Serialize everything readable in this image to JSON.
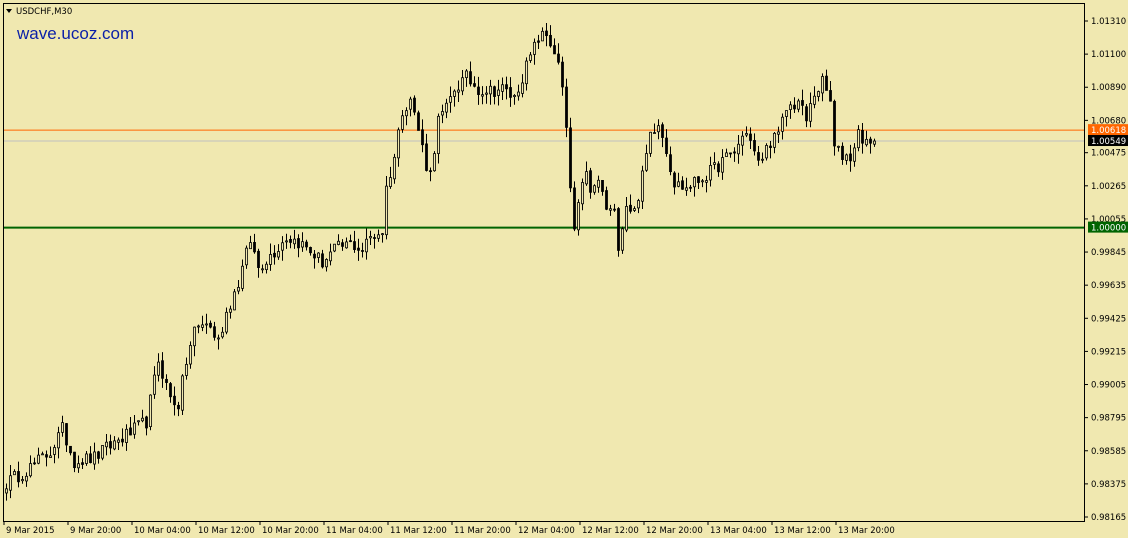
{
  "header": {
    "symbol_label": "USDCHF,M30",
    "watermark": "wave.ucoz.com"
  },
  "colors": {
    "background": "#f0e8b0",
    "candle_up_body": "#f0e8b0",
    "candle_down_body": "#000000",
    "wick": "#000000",
    "orange_line": "#ff6600",
    "green_line": "#006400",
    "bid_line": "#c0c0c0",
    "watermark": "#0a1fa8"
  },
  "chart_data": {
    "type": "candlestick",
    "symbol": "USDCHF",
    "timeframe": "M30",
    "ylim": [
      0.98165,
      1.0131
    ],
    "price_ticks": [
      "1.01310",
      "1.01100",
      "1.00890",
      "1.00680",
      "1.00475",
      "1.00265",
      "1.00055",
      "0.99845",
      "0.99635",
      "0.99425",
      "0.99215",
      "0.99005",
      "0.98795",
      "0.98585",
      "0.98375",
      "0.98165"
    ],
    "time_labels": [
      "9 Mar 2015",
      "9 Mar 20:00",
      "10 Mar 04:00",
      "10 Mar 12:00",
      "10 Mar 20:00",
      "11 Mar 04:00",
      "11 Mar 12:00",
      "11 Mar 20:00",
      "12 Mar 04:00",
      "12 Mar 12:00",
      "12 Mar 20:00",
      "13 Mar 04:00",
      "13 Mar 12:00",
      "13 Mar 20:00"
    ],
    "time_label_bars": [
      0,
      16,
      32,
      48,
      64,
      80,
      96,
      112,
      128,
      144,
      160,
      176,
      192,
      208
    ],
    "horizontal_lines": [
      {
        "label": "1.00618",
        "price": 1.00618,
        "color": "#ff6600"
      },
      {
        "label": "1.00000",
        "price": 1.0,
        "color": "#006400"
      }
    ],
    "bid": {
      "label": "1.00549",
      "price": 1.00549,
      "color": "#c0c0c0"
    },
    "path": [
      [
        0,
        0.9838
      ],
      [
        6,
        0.9848
      ],
      [
        11,
        0.9858
      ],
      [
        14,
        0.9872
      ],
      [
        17,
        0.9852
      ],
      [
        22,
        0.9854
      ],
      [
        26,
        0.9862
      ],
      [
        31,
        0.987
      ],
      [
        35,
        0.9877
      ],
      [
        38,
        0.9916
      ],
      [
        41,
        0.9892
      ],
      [
        43,
        0.9888
      ],
      [
        45,
        0.9915
      ],
      [
        47,
        0.9935
      ],
      [
        50,
        0.994
      ],
      [
        53,
        0.9928
      ],
      [
        55,
        0.9946
      ],
      [
        58,
        0.9965
      ],
      [
        61,
        0.9992
      ],
      [
        63,
        0.9975
      ],
      [
        67,
        0.9985
      ],
      [
        70,
        0.9994
      ],
      [
        73,
        0.9991
      ],
      [
        76,
        0.9985
      ],
      [
        79,
        0.9978
      ],
      [
        82,
        0.9986
      ],
      [
        86,
        0.999
      ],
      [
        89,
        0.9986
      ],
      [
        91,
        0.9994
      ],
      [
        94,
        0.9998
      ],
      [
        95,
        1.0025
      ],
      [
        97,
        1.0045
      ],
      [
        99,
        1.0075
      ],
      [
        101,
        1.0082
      ],
      [
        103,
        1.0062
      ],
      [
        105,
        1.004
      ],
      [
        106,
        1.0034
      ],
      [
        108,
        1.0068
      ],
      [
        110,
        1.0075
      ],
      [
        112,
        1.0088
      ],
      [
        115,
        1.0095
      ],
      [
        118,
        1.0088
      ],
      [
        121,
        1.0087
      ],
      [
        124,
        1.0088
      ],
      [
        127,
        1.0082
      ],
      [
        129,
        1.0096
      ],
      [
        131,
        1.0108
      ],
      [
        133,
        1.012
      ],
      [
        135,
        1.0122
      ],
      [
        137,
        1.0112
      ],
      [
        138,
        1.0102
      ],
      [
        139,
        1.0088
      ],
      [
        140,
        1.006
      ],
      [
        141,
        1.0025
      ],
      [
        142,
        0.9998
      ],
      [
        143,
        1.0012
      ],
      [
        145,
        1.0038
      ],
      [
        146,
        1.002
      ],
      [
        148,
        1.003
      ],
      [
        150,
        1.0012
      ],
      [
        152,
        1.0008
      ],
      [
        153,
        0.999
      ],
      [
        155,
        1.0015
      ],
      [
        157,
        1.001
      ],
      [
        159,
        1.0032
      ],
      [
        161,
        1.006
      ],
      [
        163,
        1.0068
      ],
      [
        165,
        1.005
      ],
      [
        167,
        1.0028
      ],
      [
        170,
        1.0025
      ],
      [
        173,
        1.003
      ],
      [
        176,
        1.0035
      ],
      [
        179,
        1.0042
      ],
      [
        182,
        1.0048
      ],
      [
        185,
        1.0062
      ],
      [
        188,
        1.004
      ],
      [
        191,
        1.0055
      ],
      [
        193,
        1.0058
      ],
      [
        195,
        1.0075
      ],
      [
        198,
        1.008
      ],
      [
        200,
        1.0068
      ],
      [
        202,
        1.0085
      ],
      [
        204,
        1.0092
      ],
      [
        206,
        1.008
      ],
      [
        207,
        1.005
      ],
      [
        209,
        1.0046
      ],
      [
        211,
        1.0045
      ],
      [
        213,
        1.006
      ],
      [
        215,
        1.0055
      ],
      [
        216,
        1.005
      ],
      [
        217,
        1.00549
      ]
    ]
  }
}
